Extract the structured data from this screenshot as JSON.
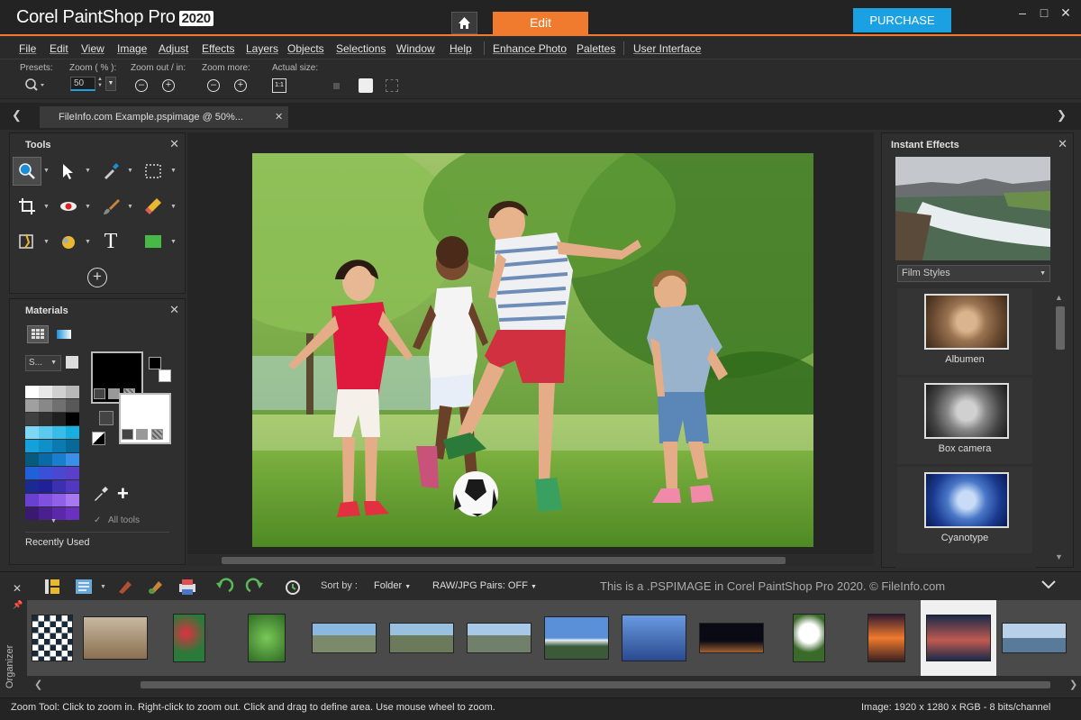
{
  "titlebar": {
    "app_name": "Corel PaintShop Pro",
    "app_year": "2020",
    "edit_tab": "Edit",
    "purchase": "PURCHASE",
    "minimize": "–",
    "maximize": "□",
    "close": "✕"
  },
  "menu": [
    "File",
    "Edit",
    "View",
    "Image",
    "Adjust",
    "Effects",
    "Layers",
    "Objects",
    "Selections",
    "Window",
    "Help",
    "Enhance Photo",
    "Palettes",
    "User Interface"
  ],
  "toolbar": {
    "presets": "Presets:",
    "zoom_pct": "Zoom ( % ):",
    "zoom_value": "50",
    "zoom_out": "Zoom out / in:",
    "zoom_more": "Zoom more:",
    "actual_size": "Actual size:",
    "actual_icon": "1:1"
  },
  "document_tab": {
    "title": "FileInfo.com Example.pspimage @  50%..."
  },
  "tools_panel": {
    "title": "Tools",
    "tools": [
      "zoom-icon",
      "pick-arrow-icon",
      "dropper-icon",
      "selection-rect-icon",
      "crop-icon",
      "red-eye-icon",
      "brush-icon",
      "eraser-icon",
      "straighten-icon",
      "fill-icon",
      "text-icon",
      "rectangle-shape-icon"
    ],
    "text_tool_glyph": "T"
  },
  "materials_panel": {
    "title": "Materials",
    "style_select": "S...",
    "all_tools": "All tools",
    "recently_used": "Recently Used",
    "palette_rows": [
      [
        "#ffffff",
        "#e8e8e8",
        "#d0d0d0",
        "#b8b8b8"
      ],
      [
        "#a0a0a0",
        "#888888",
        "#707070",
        "#585858"
      ],
      [
        "#404040",
        "#303030",
        "#202020",
        "#000000"
      ],
      [
        "#7fd6f5",
        "#5cc9f0",
        "#38bde9",
        "#1aaee0"
      ],
      [
        "#14a0d8",
        "#1090c8",
        "#0c7ab0",
        "#086898"
      ],
      [
        "#065a80",
        "#0a6aa8",
        "#1a7ed0",
        "#3a90e8"
      ],
      [
        "#2060d8",
        "#3a50d8",
        "#4a48d0",
        "#5a40c8"
      ],
      [
        "#1a2a90",
        "#202098",
        "#3a30b0",
        "#5038c0"
      ],
      [
        "#6a40d0",
        "#8050e0",
        "#9060e8",
        "#a878f0"
      ],
      [
        "#3a1a70",
        "#4a2090",
        "#5a28a8",
        "#6a30c0"
      ]
    ],
    "foreground_color": "#000000",
    "background_color": "#ffffff"
  },
  "effects_panel": {
    "title": "Instant Effects",
    "category": "Film Styles",
    "items": [
      {
        "label": "Albumen"
      },
      {
        "label": "Box camera"
      },
      {
        "label": "Cyanotype"
      }
    ]
  },
  "organizer": {
    "side_label": "Organizer",
    "sort_label": "Sort by :",
    "sort_value": "Folder",
    "raw_pairs": "RAW/JPG Pairs: OFF",
    "watermark": "This is a .PSPIMAGE in Corel PaintShop Pro 2020. © FileInfo.com",
    "thumbs": [
      "checker",
      "ostrich",
      "flowers",
      "leaves",
      "pano-road-1",
      "pano-road-2",
      "pano-road-3",
      "mountain",
      "city-water",
      "night-road",
      "cockatoo",
      "sunset",
      "lake-pin",
      "harbor"
    ]
  },
  "status": {
    "hint": "Zoom Tool: Click to zoom in. Right-click to zoom out. Click and drag to define area. Use mouse wheel to zoom.",
    "image_info": "Image:  1920 x 1280 x RGB - 8 bits/channel"
  },
  "colors": {
    "accent": "#f07a2e",
    "purchase": "#1ba1e2"
  }
}
